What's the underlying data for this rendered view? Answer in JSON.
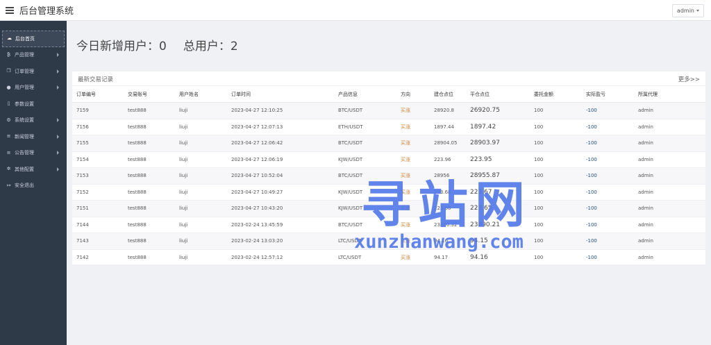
{
  "header": {
    "title": "后台管理系统",
    "user": "admin"
  },
  "sidebar": {
    "items": [
      {
        "label": "后台首页",
        "icon": "dashboard-icon",
        "glyph": "☁",
        "active": true,
        "arrow": false
      },
      {
        "label": "产品管理",
        "icon": "bitcoin-icon",
        "glyph": "₿",
        "active": false,
        "arrow": true
      },
      {
        "label": "订单管理",
        "icon": "copy-icon",
        "glyph": "❐",
        "active": false,
        "arrow": true
      },
      {
        "label": "用户管理",
        "icon": "user-icon",
        "glyph": "●",
        "active": false,
        "arrow": true
      },
      {
        "label": "参数设置",
        "icon": "file-icon",
        "glyph": "▯",
        "active": false,
        "arrow": false
      },
      {
        "label": "系统设置",
        "icon": "gears-icon",
        "glyph": "⚙",
        "active": false,
        "arrow": true
      },
      {
        "label": "新闻管理",
        "icon": "list-icon",
        "glyph": "≡",
        "active": false,
        "arrow": true
      },
      {
        "label": "公告管理",
        "icon": "list-icon",
        "glyph": "≡",
        "active": false,
        "arrow": true
      },
      {
        "label": "其他配置",
        "icon": "gear-icon",
        "glyph": "✲",
        "active": false,
        "arrow": true
      },
      {
        "label": "安全退出",
        "icon": "logout-icon",
        "glyph": "↦",
        "active": false,
        "arrow": false
      }
    ]
  },
  "stats": {
    "today_label": "今日新增用户：",
    "today_value": "0",
    "total_label": "总用户：",
    "total_value": "2"
  },
  "panel": {
    "title": "最新交易记录",
    "more": "更多>>"
  },
  "table": {
    "columns": [
      "订单编号",
      "交易账号",
      "用户姓名",
      "订单时间",
      "产品信息",
      "方向",
      "建仓点位",
      "平仓点位",
      "委托金额",
      "实际盈亏",
      "所属代理"
    ],
    "rows": [
      [
        "7159",
        "test888",
        "liuji",
        "2023-04-27 12:10:25",
        "BTC/USDT",
        "买涨",
        "28920.8",
        "26920.75",
        "100",
        "-100",
        "admin"
      ],
      [
        "7156",
        "test888",
        "liuji",
        "2023-04-27 12:07:13",
        "ETH/USDT",
        "买涨",
        "1897.44",
        "1897.42",
        "100",
        "-100",
        "admin"
      ],
      [
        "7155",
        "test888",
        "liuji",
        "2023-04-27 12:06:42",
        "BTC/USDT",
        "买涨",
        "28904.05",
        "28903.97",
        "100",
        "-100",
        "admin"
      ],
      [
        "7154",
        "test888",
        "liuji",
        "2023-04-27 12:06:19",
        "KJW/USDT",
        "买涨",
        "223.96",
        "223.95",
        "100",
        "-100",
        "admin"
      ],
      [
        "7153",
        "test888",
        "liuji",
        "2023-04-27 10:52:04",
        "BTC/USDT",
        "买涨",
        "28956",
        "28955.87",
        "100",
        "-100",
        "admin"
      ],
      [
        "7152",
        "test888",
        "liuji",
        "2023-04-27 10:49:27",
        "KJW/USDT",
        "买涨",
        "223.68",
        "223.67",
        "100",
        "-100",
        "admin"
      ],
      [
        "7151",
        "test888",
        "liuji",
        "2023-04-27 10:43:20",
        "KJW/USDT",
        "买涨",
        "223.66",
        "223.65",
        "100",
        "-100",
        "admin"
      ],
      [
        "7144",
        "test888",
        "liuji",
        "2023-02-24 13:45:59",
        "BTC/USDT",
        "买涨",
        "23890.32",
        "23890.21",
        "100",
        "-100",
        "admin"
      ],
      [
        "7143",
        "test888",
        "liuji",
        "2023-02-24 13:03:20",
        "LTC/USDT",
        "买涨",
        "94.16",
        "94.15",
        "100",
        "-100",
        "admin"
      ],
      [
        "7142",
        "test888",
        "liuji",
        "2023-02-24 12:57:12",
        "LTC/USDT",
        "买涨",
        "94.17",
        "94.16",
        "100",
        "-100",
        "admin"
      ]
    ]
  },
  "watermark": {
    "cn": "寻站网",
    "en": "xunzhanwang.com"
  }
}
